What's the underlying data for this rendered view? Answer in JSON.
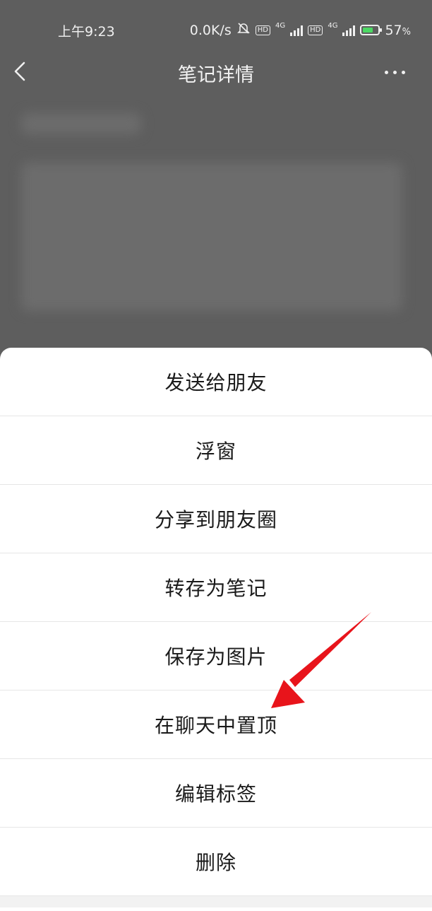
{
  "status_bar": {
    "time": "上午9:23",
    "network_speed": "0.0K/s",
    "battery_percent": "57",
    "battery_unit": "%",
    "hd1": "HD",
    "hd2": "HD",
    "net1": "4G",
    "net2": "4G"
  },
  "nav": {
    "title": "笔记详情",
    "back_icon": "chevron-left-icon",
    "more_icon": "more-horizontal-icon"
  },
  "action_sheet": {
    "items": [
      {
        "label": "发送给朋友"
      },
      {
        "label": "浮窗"
      },
      {
        "label": "分享到朋友圈"
      },
      {
        "label": "转存为笔记"
      },
      {
        "label": "保存为图片"
      },
      {
        "label": "在聊天中置顶"
      },
      {
        "label": "编辑标签"
      },
      {
        "label": "删除"
      }
    ]
  },
  "annotation": {
    "arrow_color": "#e8141b",
    "points_to": "在聊天中置顶"
  }
}
